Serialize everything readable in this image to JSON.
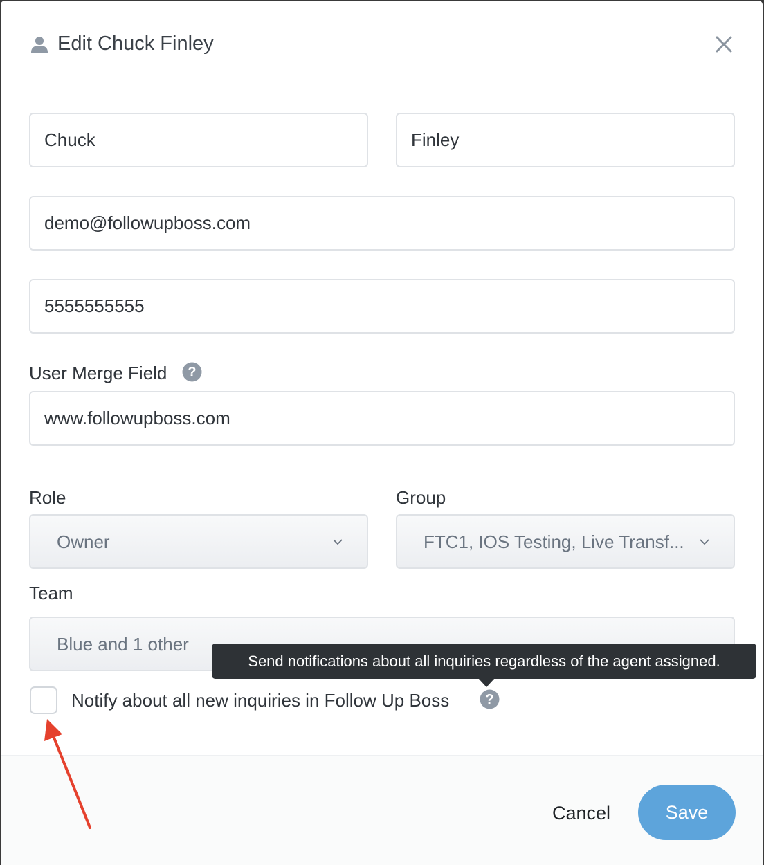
{
  "header": {
    "title": "Edit Chuck Finley",
    "icon": "user-icon"
  },
  "form": {
    "first_name": "Chuck",
    "last_name": "Finley",
    "email": "demo@followupboss.com",
    "phone": "5555555555",
    "merge_field_label": "User Merge Field",
    "merge_field_value": "www.followupboss.com",
    "role_label": "Role",
    "role_value": "Owner",
    "group_label": "Group",
    "group_value": "FTC1, IOS Testing, Live Transf...",
    "team_label": "Team",
    "team_value": "Blue and 1 other",
    "notify_label": "Notify about all new inquiries in Follow Up Boss",
    "notify_checked": false
  },
  "tooltip": {
    "text": "Send notifications about all inquiries regardless of the agent assigned."
  },
  "footer": {
    "cancel_label": "Cancel",
    "save_label": "Save"
  },
  "colors": {
    "save_button": "#5da4db",
    "tooltip_bg": "#2e3236",
    "annotation_arrow": "#e5412d",
    "help_icon": "#8f99a5"
  }
}
